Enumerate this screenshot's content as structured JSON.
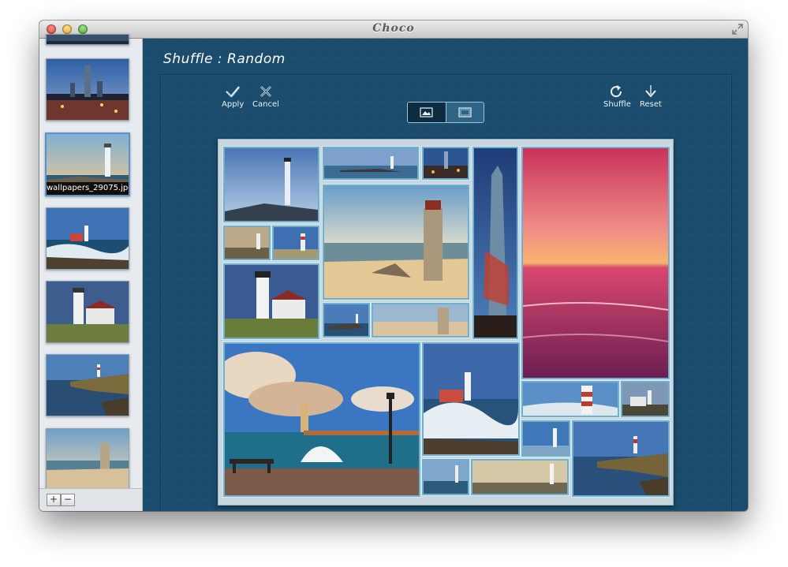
{
  "window": {
    "title": "Choco"
  },
  "sidebar": {
    "items": [
      {
        "name": "",
        "selected": false
      },
      {
        "name": "wallpapers_29075.jpg",
        "selected": true
      },
      {
        "name": "",
        "selected": false
      },
      {
        "name": "",
        "selected": false
      },
      {
        "name": "",
        "selected": false
      },
      {
        "name": "",
        "selected": false
      }
    ],
    "add_label": "+",
    "remove_label": "−"
  },
  "main": {
    "heading": "Shuffle : Random",
    "toolbar": {
      "apply_label": "Apply",
      "cancel_label": "Cancel",
      "shuffle_label": "Shuffle",
      "reset_label": "Reset",
      "view_mode_selected": "first"
    }
  },
  "colors": {
    "background": "#1b4c6d",
    "tile_border": "#6fb0cf",
    "toolbar_text": "#eaf3f8"
  },
  "icons": [
    "checkmark-icon",
    "cancel-icon",
    "shuffle-icon",
    "reset-icon",
    "single-image-icon",
    "multi-image-icon",
    "fullscreen-icon"
  ]
}
